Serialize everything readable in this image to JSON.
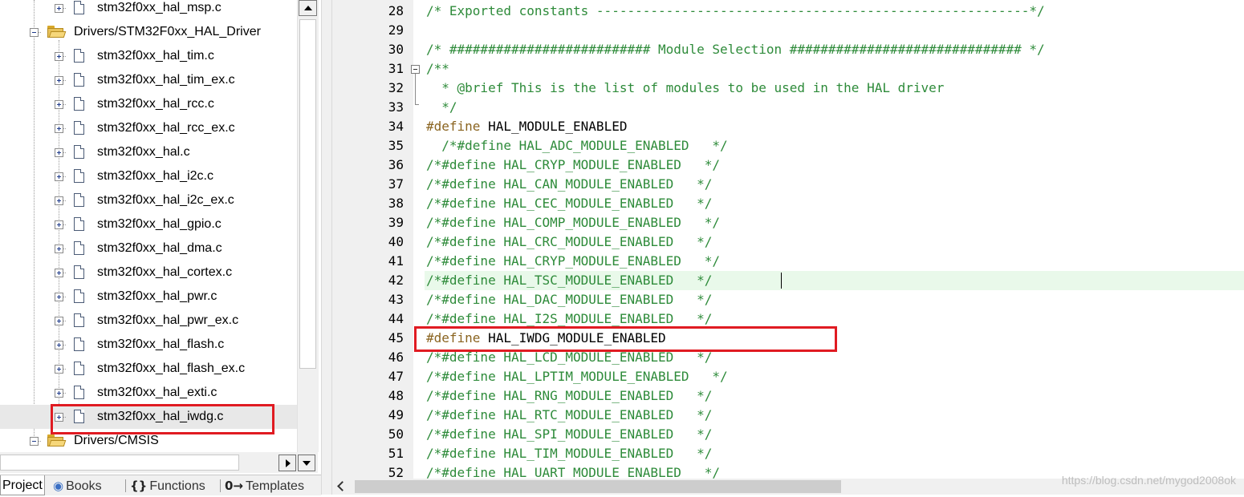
{
  "project_panel": {
    "tree": [
      {
        "label": "stm32f0xx_hal_msp.c",
        "kind": "file",
        "expander": "plus"
      },
      {
        "label": "Drivers/STM32F0xx_HAL_Driver",
        "kind": "folder",
        "expander": "minus"
      },
      {
        "label": "stm32f0xx_hal_tim.c",
        "kind": "file",
        "expander": "plus"
      },
      {
        "label": "stm32f0xx_hal_tim_ex.c",
        "kind": "file",
        "expander": "plus"
      },
      {
        "label": "stm32f0xx_hal_rcc.c",
        "kind": "file",
        "expander": "plus"
      },
      {
        "label": "stm32f0xx_hal_rcc_ex.c",
        "kind": "file",
        "expander": "plus"
      },
      {
        "label": "stm32f0xx_hal.c",
        "kind": "file",
        "expander": "plus"
      },
      {
        "label": "stm32f0xx_hal_i2c.c",
        "kind": "file",
        "expander": "plus"
      },
      {
        "label": "stm32f0xx_hal_i2c_ex.c",
        "kind": "file",
        "expander": "plus"
      },
      {
        "label": "stm32f0xx_hal_gpio.c",
        "kind": "file",
        "expander": "plus"
      },
      {
        "label": "stm32f0xx_hal_dma.c",
        "kind": "file",
        "expander": "plus"
      },
      {
        "label": "stm32f0xx_hal_cortex.c",
        "kind": "file",
        "expander": "plus"
      },
      {
        "label": "stm32f0xx_hal_pwr.c",
        "kind": "file",
        "expander": "plus"
      },
      {
        "label": "stm32f0xx_hal_pwr_ex.c",
        "kind": "file",
        "expander": "plus"
      },
      {
        "label": "stm32f0xx_hal_flash.c",
        "kind": "file",
        "expander": "plus"
      },
      {
        "label": "stm32f0xx_hal_flash_ex.c",
        "kind": "file",
        "expander": "plus"
      },
      {
        "label": "stm32f0xx_hal_exti.c",
        "kind": "file",
        "expander": "plus"
      },
      {
        "label": "stm32f0xx_hal_iwdg.c",
        "kind": "file",
        "expander": "plus",
        "selected": true
      },
      {
        "label": "Drivers/CMSIS",
        "kind": "folder",
        "expander": "minus"
      }
    ],
    "tabs": [
      {
        "label": "Project",
        "icon": "project-icon",
        "active": true
      },
      {
        "label": "Books",
        "icon": "books-icon"
      },
      {
        "label": "Functions",
        "icon": "{}"
      },
      {
        "label": "Templates",
        "icon": "0→"
      }
    ]
  },
  "editor": {
    "lines": [
      {
        "num": "28",
        "type": "comment",
        "text": "/* Exported constants --------------------------------------------------------*/"
      },
      {
        "num": "29",
        "type": "blank",
        "text": ""
      },
      {
        "num": "30",
        "type": "comment",
        "text": "/* ########################## Module Selection ############################## */"
      },
      {
        "num": "31",
        "type": "comment",
        "text": "/**",
        "fold": "start"
      },
      {
        "num": "32",
        "type": "comment",
        "text": "  * @brief This is the list of modules to be used in the HAL driver"
      },
      {
        "num": "33",
        "type": "comment",
        "text": "  */",
        "fold": "end"
      },
      {
        "num": "34",
        "type": "define",
        "pre": "#define",
        "rest": " HAL_MODULE_ENABLED"
      },
      {
        "num": "35",
        "type": "comment",
        "text": "  /*#define HAL_ADC_MODULE_ENABLED   */"
      },
      {
        "num": "36",
        "type": "comment",
        "text": "/*#define HAL_CRYP_MODULE_ENABLED   */"
      },
      {
        "num": "37",
        "type": "comment",
        "text": "/*#define HAL_CAN_MODULE_ENABLED   */"
      },
      {
        "num": "38",
        "type": "comment",
        "text": "/*#define HAL_CEC_MODULE_ENABLED   */"
      },
      {
        "num": "39",
        "type": "comment",
        "text": "/*#define HAL_COMP_MODULE_ENABLED   */"
      },
      {
        "num": "40",
        "type": "comment",
        "text": "/*#define HAL_CRC_MODULE_ENABLED   */"
      },
      {
        "num": "41",
        "type": "comment",
        "text": "/*#define HAL_CRYP_MODULE_ENABLED   */"
      },
      {
        "num": "42",
        "type": "comment",
        "text": "/*#define HAL_TSC_MODULE_ENABLED   */",
        "current": true
      },
      {
        "num": "43",
        "type": "comment",
        "text": "/*#define HAL_DAC_MODULE_ENABLED   */"
      },
      {
        "num": "44",
        "type": "comment",
        "text": "/*#define HAL_I2S_MODULE_ENABLED   */"
      },
      {
        "num": "45",
        "type": "define",
        "pre": "#define",
        "rest": " HAL_IWDG_MODULE_ENABLED",
        "boxed": true
      },
      {
        "num": "46",
        "type": "comment",
        "text": "/*#define HAL_LCD_MODULE_ENABLED   */"
      },
      {
        "num": "47",
        "type": "comment",
        "text": "/*#define HAL_LPTIM_MODULE_ENABLED   */"
      },
      {
        "num": "48",
        "type": "comment",
        "text": "/*#define HAL_RNG_MODULE_ENABLED   */"
      },
      {
        "num": "49",
        "type": "comment",
        "text": "/*#define HAL_RTC_MODULE_ENABLED   */"
      },
      {
        "num": "50",
        "type": "comment",
        "text": "/*#define HAL_SPI_MODULE_ENABLED   */"
      },
      {
        "num": "51",
        "type": "comment",
        "text": "/*#define HAL_TIM_MODULE_ENABLED   */"
      },
      {
        "num": "52",
        "type": "comment",
        "text": "/*#define HAL_UART_MODULE_ENABLED   */"
      }
    ]
  },
  "watermark": "https://blog.csdn.net/mygod2008ok",
  "colors": {
    "comment": "#2e8b3a",
    "preprocessor": "#8a6420",
    "highlight_box": "#e01b22",
    "current_line": "#e9f9ea"
  }
}
